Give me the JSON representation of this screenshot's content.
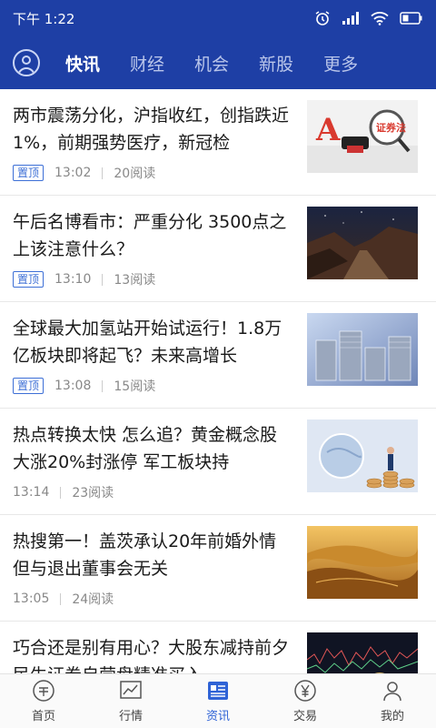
{
  "status": {
    "time": "下午 1:22"
  },
  "tabs": [
    {
      "label": "快讯",
      "active": true
    },
    {
      "label": "财经",
      "active": false
    },
    {
      "label": "机会",
      "active": false
    },
    {
      "label": "新股",
      "active": false
    },
    {
      "label": "更多",
      "active": false
    }
  ],
  "news": [
    {
      "title": "两市震荡分化，沪指收红，创指跌近1%，前期强势医疗，新冠检",
      "badge": "置顶",
      "time": "13:02",
      "reads": "20阅读"
    },
    {
      "title": "午后名博看市：严重分化 3500点之上该注意什么？",
      "badge": "置顶",
      "time": "13:10",
      "reads": "13阅读"
    },
    {
      "title": "全球最大加氢站开始试运行！1.8万亿板块即将起飞？未来高增长",
      "badge": "置顶",
      "time": "13:08",
      "reads": "15阅读"
    },
    {
      "title": "热点转换太快 怎么追？黄金概念股大涨20%封涨停 军工板块持",
      "badge": "",
      "time": "13:14",
      "reads": "23阅读"
    },
    {
      "title": "热搜第一！盖茨承认20年前婚外情 但与退出董事会无关",
      "badge": "",
      "time": "13:05",
      "reads": "24阅读"
    },
    {
      "title": "巧合还是别有用心？大股东减持前夕 民生证券自营盘精准买入",
      "badge": "",
      "time": "",
      "reads": ""
    }
  ],
  "thumb_texts": {
    "zhengquanfa": "证券法",
    "letter_a": "A"
  },
  "bottom_nav": [
    {
      "label": "首页",
      "icon": "coupon-icon",
      "active": false
    },
    {
      "label": "行情",
      "icon": "chart-icon",
      "active": false
    },
    {
      "label": "资讯",
      "icon": "news-icon",
      "active": true
    },
    {
      "label": "交易",
      "icon": "yen-icon",
      "active": false
    },
    {
      "label": "我的",
      "icon": "user-icon",
      "active": false
    }
  ],
  "colors": {
    "header": "#1e3fa5",
    "accent": "#2f63d6",
    "badge": "#3d6fd6"
  }
}
